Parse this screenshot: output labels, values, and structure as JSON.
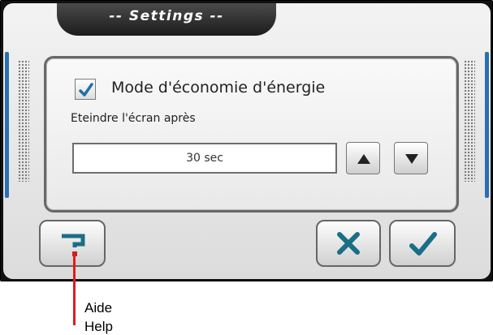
{
  "title": "-- Settings --",
  "setting": {
    "checkbox_checked": true,
    "label": "Mode d'économie d'énergie",
    "sub_label": "Eteindre l'écran après",
    "value": "30 sec"
  },
  "buttons": {
    "up_icon": "arrow-up-icon",
    "down_icon": "arrow-down-icon",
    "help_icon": "help-icon",
    "cancel_icon": "cancel-x-icon",
    "ok_icon": "checkmark-icon"
  },
  "callout": {
    "label": "Aide",
    "label2": "Help"
  },
  "colors": {
    "accent_blue": "#2a6fb0",
    "checkmark_blue": "#1f6fa8",
    "icon_teal": "#1a6e86",
    "help_red": "#d21f1f",
    "callout_red": "#e01c1c"
  }
}
